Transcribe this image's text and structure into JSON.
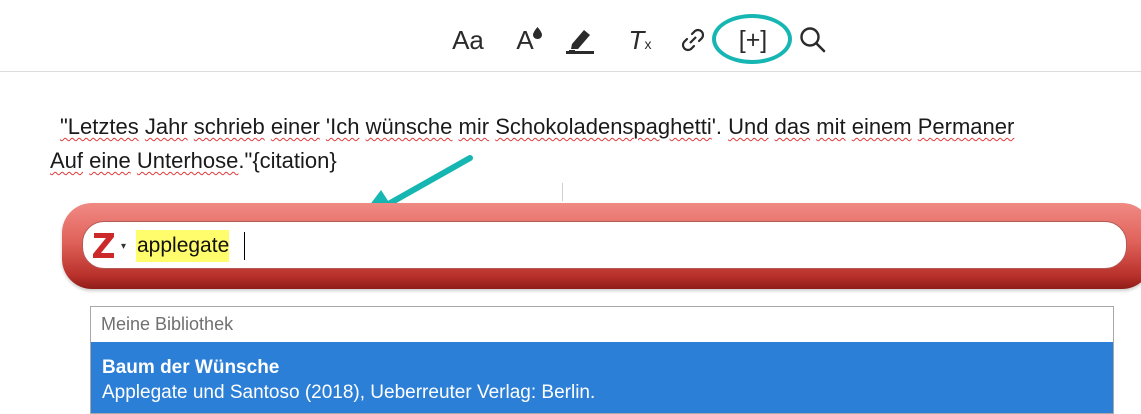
{
  "toolbar": {
    "font_size_label": "Aa",
    "font_color_label": "A",
    "clear_format_label": "T",
    "clear_format_sub": "x",
    "insert_citation_label": "[+]",
    "accent_color": "#16b6b2",
    "icons": [
      "font-size-icon",
      "font-color-icon",
      "highlighter-icon",
      "clear-format-icon",
      "link-icon",
      "insert-citation-icon",
      "search-icon"
    ]
  },
  "document": {
    "line1": {
      "w1": "\"Letztes",
      "w2": "Jahr",
      "w3": "schrieb",
      "w4": "einer",
      "w5": "'Ich",
      "w6": "wünsche",
      "w7": "mir",
      "w8": "Schokoladenspaghetti",
      "p1": "'.",
      "w9": "Und",
      "w10": "das",
      "w11": "mit",
      "w12": "einem",
      "w13": "Permaner"
    },
    "line2": {
      "w1": "Auf",
      "w2": "eine",
      "w3": "Unterhose",
      "tail": ".\"{citation}"
    }
  },
  "zotero": {
    "bar_color": "#c8423b",
    "query": "applegate",
    "library_label": "Meine Bibliothek",
    "results": [
      {
        "title": "Baum der Wünsche",
        "detail": "Applegate und Santoso (2018), Ueberreuter Verlag: Berlin."
      }
    ],
    "selected_color": "#2c7fd6"
  }
}
